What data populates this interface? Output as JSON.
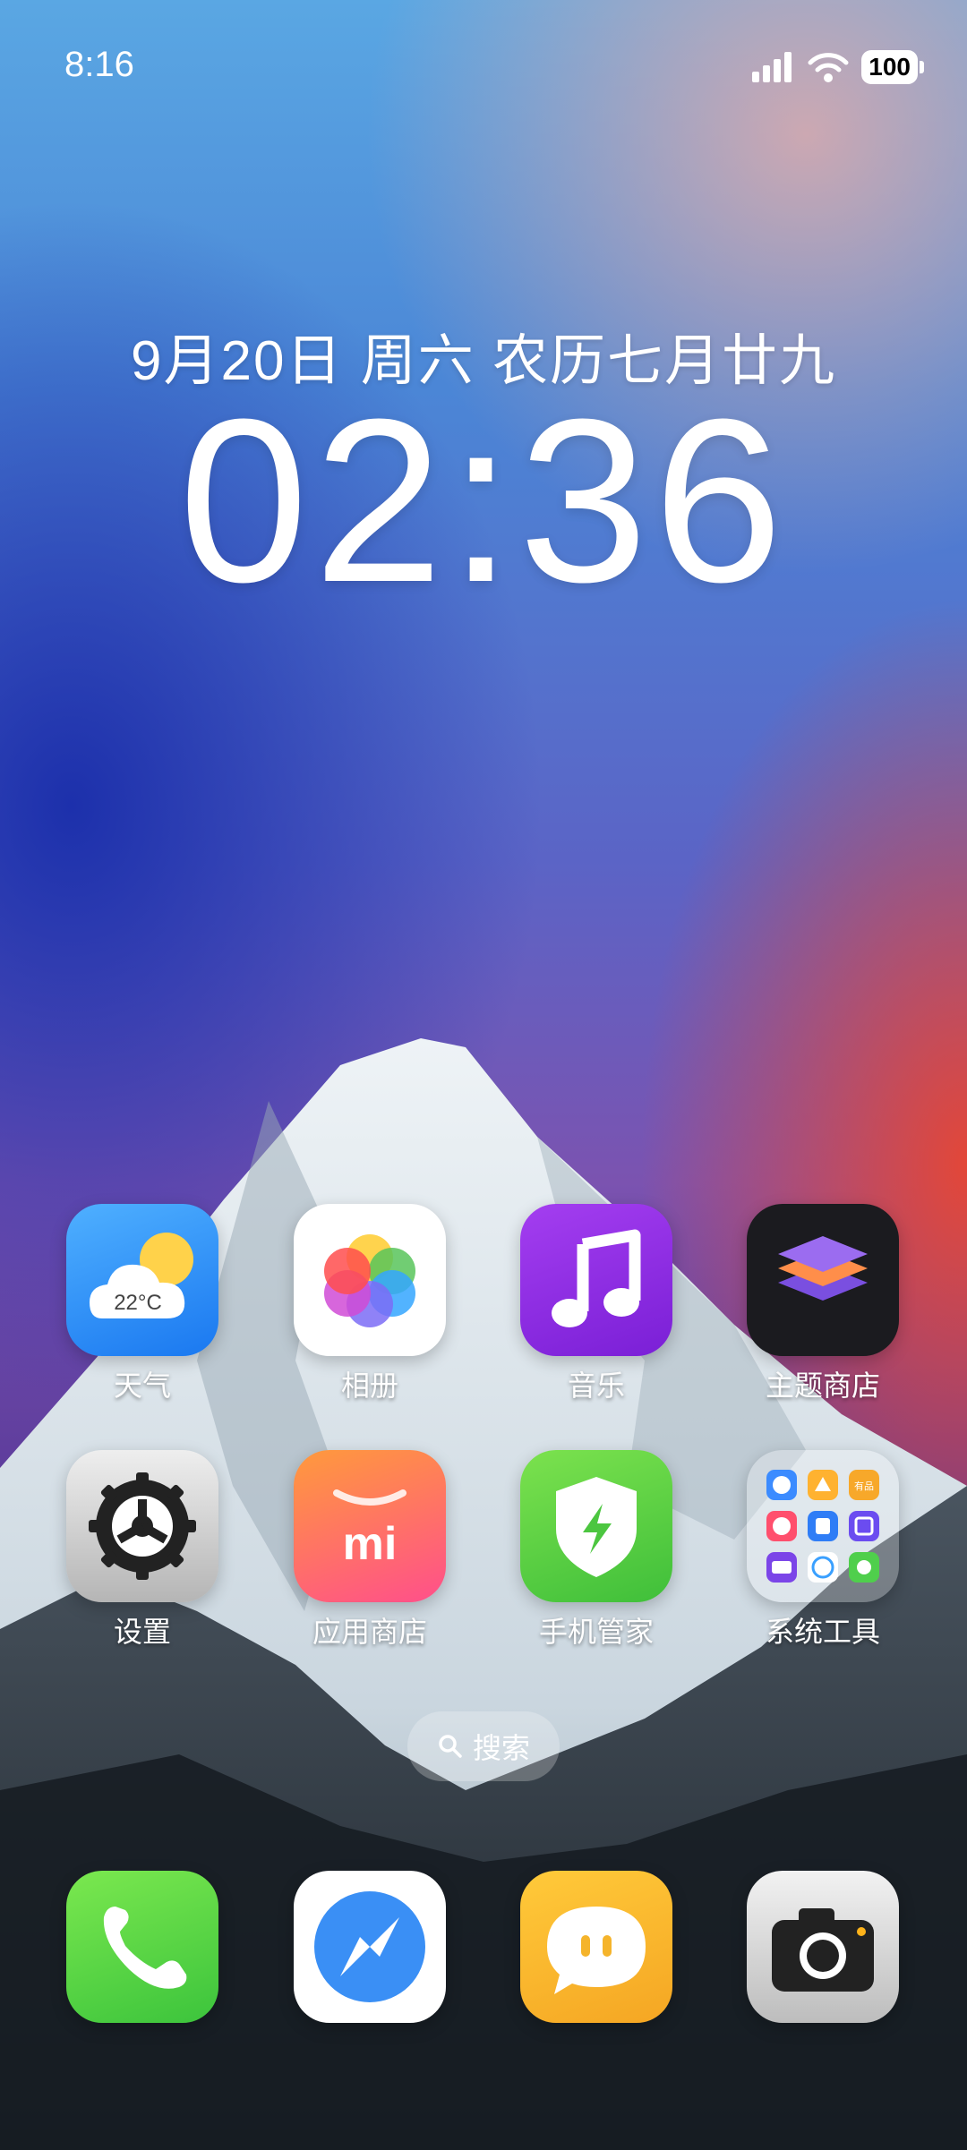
{
  "status_bar": {
    "time": "8:16",
    "battery": "100"
  },
  "lock": {
    "date": "9月20日 周六 农历七月廿九",
    "clock": "02:36"
  },
  "apps": [
    {
      "label": "天气",
      "icon": "weather-icon",
      "temp": "22°C"
    },
    {
      "label": "相册",
      "icon": "gallery-icon"
    },
    {
      "label": "音乐",
      "icon": "music-icon"
    },
    {
      "label": "主题商店",
      "icon": "themes-icon"
    },
    {
      "label": "设置",
      "icon": "settings-icon"
    },
    {
      "label": "应用商店",
      "icon": "mi-app-store-icon",
      "logo_text": "mi"
    },
    {
      "label": "手机管家",
      "icon": "security-icon"
    },
    {
      "label": "系统工具",
      "icon": "folder-icon",
      "folder_mini_text": "有品"
    }
  ],
  "search": {
    "label": "搜索"
  },
  "dock": [
    {
      "icon": "phone-icon"
    },
    {
      "icon": "browser-icon"
    },
    {
      "icon": "messages-icon"
    },
    {
      "icon": "camera-icon"
    }
  ],
  "colors": {
    "music": "#8b2de0",
    "security": "#5dd64b",
    "phone": "#54d14a",
    "messages": "#f6bb3a"
  }
}
